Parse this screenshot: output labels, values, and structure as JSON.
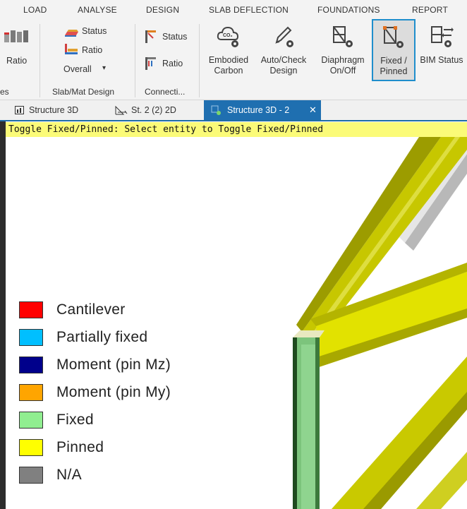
{
  "menu": [
    "LOAD",
    "ANALYSE",
    "DESIGN",
    "SLAB DEFLECTION",
    "FOUNDATIONS",
    "REPORT"
  ],
  "ribbon": {
    "left_partial": {
      "ratio_label": "Ratio",
      "group_fragment": "es"
    },
    "slab_mat": {
      "status": "Status",
      "ratio": "Ratio",
      "overall": "Overall",
      "dropdown": "▾",
      "group_label": "Slab/Mat Design"
    },
    "connection": {
      "status": "Status",
      "ratio": "Ratio",
      "group_label": "Connecti..."
    },
    "big_buttons": [
      {
        "line1": "Embodied",
        "line2": "Carbon",
        "icon": "co2-cloud-gear-icon"
      },
      {
        "line1": "Auto/Check",
        "line2": "Design",
        "icon": "pencil-gear-icon"
      },
      {
        "line1": "Diaphragm",
        "line2": "On/Off",
        "icon": "diaphragm-gear-icon"
      },
      {
        "line1": "Fixed /",
        "line2": "Pinned",
        "icon": "fixed-pinned-gear-icon",
        "active": true
      },
      {
        "line1": "BIM Status",
        "line2": "",
        "icon": "bim-arrows-gear-icon"
      }
    ]
  },
  "tabs": [
    {
      "label": "Structure 3D",
      "icon": "chart-icon"
    },
    {
      "label": "St. 2 (2) 2D",
      "icon": "frame-2d-icon"
    },
    {
      "label": "Structure 3D - 2",
      "icon": "model-3d-icon",
      "active": true,
      "close": "✕"
    }
  ],
  "hint": "Toggle Fixed/Pinned: Select entity to Toggle Fixed/Pinned",
  "legend": [
    {
      "label": "Cantilever",
      "color": "#ff0000"
    },
    {
      "label": "Partially fixed",
      "color": "#00bfff"
    },
    {
      "label": "Moment (pin Mz)",
      "color": "#00008b"
    },
    {
      "label": "Moment (pin My)",
      "color": "#ffa500"
    },
    {
      "label": "Fixed",
      "color": "#90ee90"
    },
    {
      "label": "Pinned",
      "color": "#ffff00"
    },
    {
      "label": "N/A",
      "color": "#808080"
    }
  ],
  "colors": {
    "accent": "#1f8ecc",
    "tab_active": "#1f6fb0",
    "hint_bg": "#fbfb78",
    "beam_yellow": "#c8c800",
    "column_green": "#7cc47c"
  }
}
